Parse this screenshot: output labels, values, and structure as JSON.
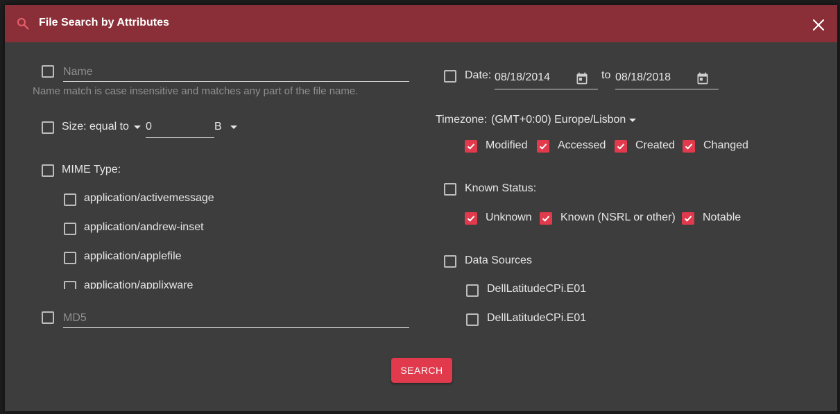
{
  "dialog": {
    "title": "File Search by Attributes",
    "accent_color": "#e03a4c",
    "header_color": "#8a2f38",
    "icons": [
      "search-icon",
      "close-icon",
      "calendar-icon",
      "caret-down-icon",
      "checkbox-icon"
    ]
  },
  "name": {
    "checked": false,
    "placeholder": "Name",
    "value": "",
    "hint": "Name match is case insensitive and matches any part of the file name."
  },
  "size": {
    "checked": false,
    "label": "Size:",
    "comparator": "equal to",
    "value": "0",
    "unit": "B"
  },
  "mime": {
    "checked": false,
    "label": "MIME Type:",
    "options": [
      {
        "label": "application/activemessage",
        "checked": false
      },
      {
        "label": "application/andrew-inset",
        "checked": false
      },
      {
        "label": "application/applefile",
        "checked": false
      },
      {
        "label": "application/applixware",
        "checked": false
      }
    ]
  },
  "md5": {
    "checked": false,
    "placeholder": "MD5",
    "value": ""
  },
  "date": {
    "checked": false,
    "label": "Date:",
    "from": "08/18/2014",
    "to_label": "to",
    "to": "08/18/2018",
    "timezone_label": "Timezone:",
    "timezone": "(GMT+0:00) Europe/Lisbon",
    "types": [
      {
        "label": "Modified",
        "checked": true
      },
      {
        "label": "Accessed",
        "checked": true
      },
      {
        "label": "Created",
        "checked": true
      },
      {
        "label": "Changed",
        "checked": true
      }
    ]
  },
  "known_status": {
    "checked": false,
    "label": "Known Status:",
    "options": [
      {
        "label": "Unknown",
        "checked": true
      },
      {
        "label": "Known (NSRL or other)",
        "checked": true
      },
      {
        "label": "Notable",
        "checked": true
      }
    ]
  },
  "data_sources": {
    "checked": false,
    "label": "Data Sources",
    "items": [
      {
        "label": "DellLatitudeCPi.E01",
        "checked": false
      },
      {
        "label": "DellLatitudeCPi.E01",
        "checked": false
      }
    ]
  },
  "search_button": {
    "label": "SEARCH"
  }
}
